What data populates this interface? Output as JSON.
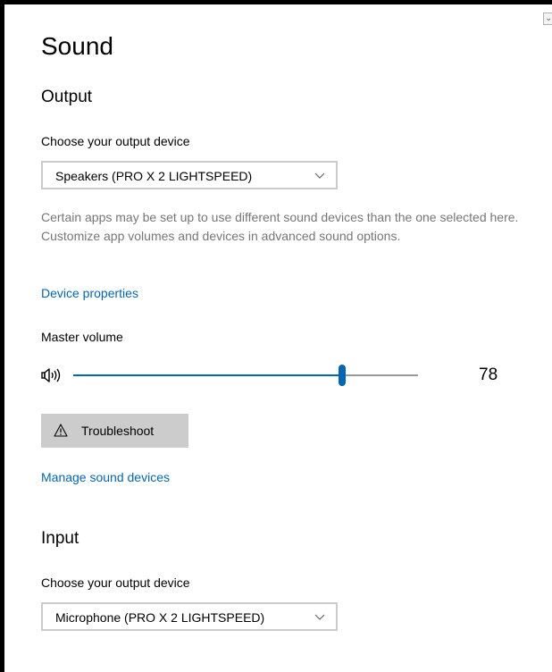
{
  "page": {
    "title": "Sound"
  },
  "output": {
    "heading": "Output",
    "device_label": "Choose your output device",
    "device_value": "Speakers (PRO X 2 LIGHTSPEED)",
    "description": "Certain apps may be set up to use different sound devices than the one selected here. Customize app volumes and devices in advanced sound options.",
    "device_properties_link": "Device properties",
    "master_volume_label": "Master volume",
    "volume_value": "78",
    "volume_level_percent": 78,
    "troubleshoot_label": "Troubleshoot",
    "manage_devices_link": "Manage sound devices"
  },
  "input": {
    "heading": "Input",
    "device_label": "Choose your output device",
    "device_value": "Microphone (PRO X 2 LIGHTSPEED)"
  },
  "icons": {
    "speaker": "speaker-volume-icon",
    "dropdown": "chevron-down-icon",
    "warning": "warning-icon"
  },
  "colors": {
    "accent": "#0067b8",
    "secondary_text": "#767676",
    "button_bg": "#cccccc",
    "dropdown_border": "#cccccc"
  }
}
